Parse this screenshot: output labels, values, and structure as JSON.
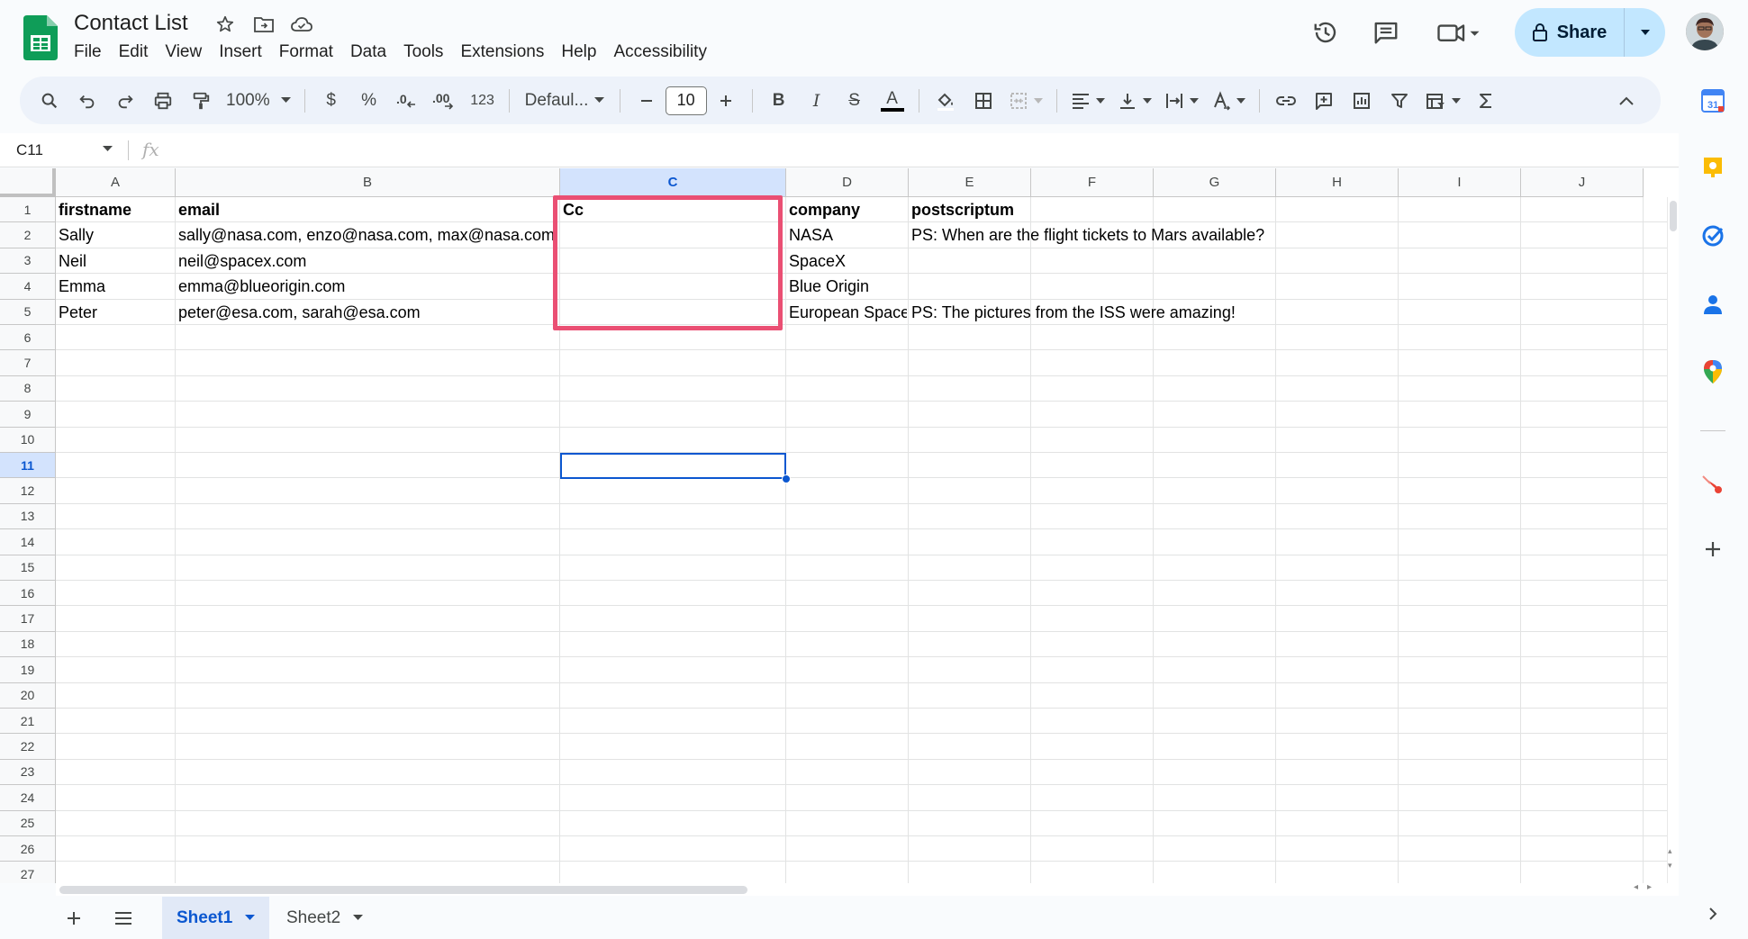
{
  "app": {
    "doc_title": "Contact List",
    "menu": [
      "File",
      "Edit",
      "View",
      "Insert",
      "Format",
      "Data",
      "Tools",
      "Extensions",
      "Help",
      "Accessibility"
    ],
    "share_label": "Share"
  },
  "toolbar": {
    "zoom": "100%",
    "currency": "$",
    "percent": "%",
    "dec_decrease": ".0",
    "dec_increase": ".00",
    "number_format": "123",
    "font": "Defaul...",
    "font_size": "10",
    "bold": "B",
    "italic": "I",
    "strikethrough": "S",
    "text_color": "A"
  },
  "formula_bar": {
    "name_box": "C11",
    "fx": "fx"
  },
  "grid": {
    "columns": [
      "A",
      "B",
      "C",
      "D",
      "E",
      "F",
      "G",
      "H",
      "I",
      "J"
    ],
    "selected_column": "C",
    "selected_row": "11",
    "rows": [
      "1",
      "2",
      "3",
      "4",
      "5",
      "6",
      "7",
      "8",
      "9",
      "10",
      "11",
      "12",
      "13",
      "14",
      "15",
      "16",
      "17",
      "18",
      "19",
      "20",
      "21",
      "22",
      "23",
      "24",
      "25",
      "26",
      "27"
    ],
    "cells": {
      "A1": "firstname",
      "B1": "email",
      "C1": "Cc",
      "D1": "company",
      "E1": "postscriptum",
      "A2": "Sally",
      "B2": "sally@nasa.com, enzo@nasa.com, max@nasa.com",
      "D2": "NASA",
      "E2": "PS: When are the flight tickets to Mars available?",
      "A3": "Neil",
      "B3": "neil@spacex.com",
      "D3": "SpaceX",
      "A4": "Emma",
      "B4": "emma@blueorigin.com",
      "D4": "Blue Origin",
      "A5": "Peter",
      "B5": "peter@esa.com, sarah@esa.com",
      "D5": "European Space",
      "E5": "PS: The pictures from the ISS were amazing!"
    },
    "highlight_color": "#ea4f73",
    "selection_color": "#0b57d0"
  },
  "sheets": {
    "tabs": [
      "Sheet1",
      "Sheet2"
    ],
    "active": "Sheet1"
  }
}
